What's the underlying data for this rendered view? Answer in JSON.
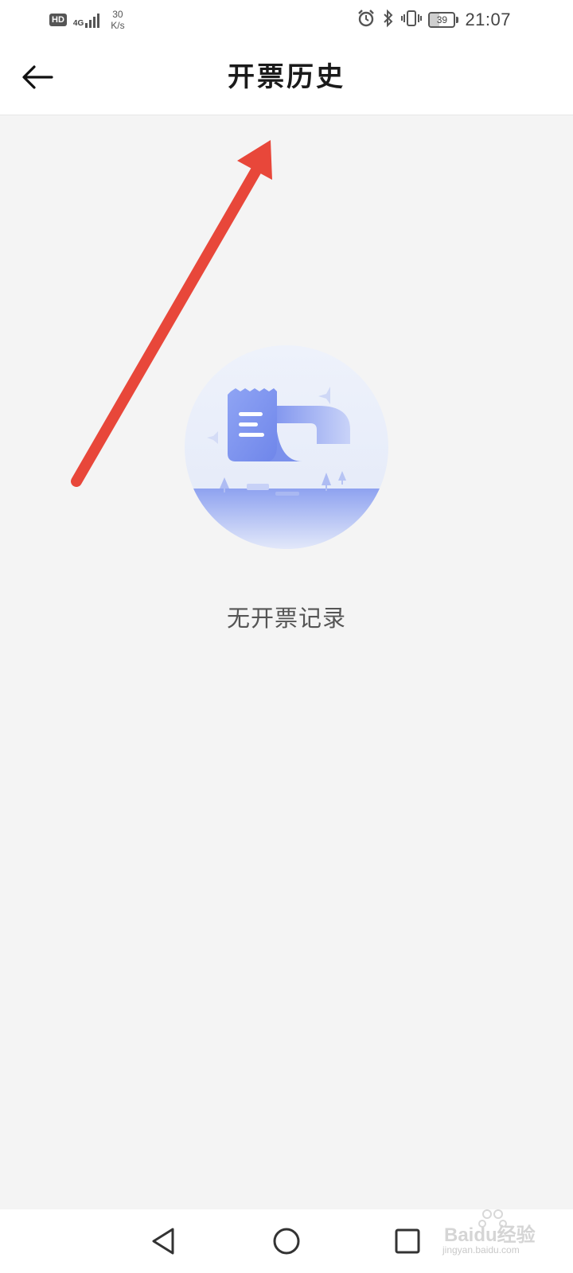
{
  "status_bar": {
    "hd_label": "HD",
    "network_type": "4G",
    "net_speed_value": "30",
    "net_speed_unit": "K/s",
    "battery_level": "39",
    "battery_fraction": 0.39,
    "time": "21:07",
    "icons": [
      "hd-icon",
      "signal-icon",
      "alarm-icon",
      "bluetooth-icon",
      "vibrate-icon",
      "battery-icon"
    ]
  },
  "header": {
    "title": "开票历史",
    "back_icon": "arrow-left-icon"
  },
  "annotation": {
    "type": "red-arrow",
    "color": "#e8473a"
  },
  "empty_state": {
    "illustration": "receipt-illustration",
    "message": "无开票记录",
    "accent_color": "#7e93ee"
  },
  "nav_bar": {
    "icons": [
      "nav-back-icon",
      "nav-home-icon",
      "nav-recent-icon"
    ]
  },
  "watermark": {
    "brand": "Baidu经验",
    "site": "jingyan.baidu.com"
  }
}
